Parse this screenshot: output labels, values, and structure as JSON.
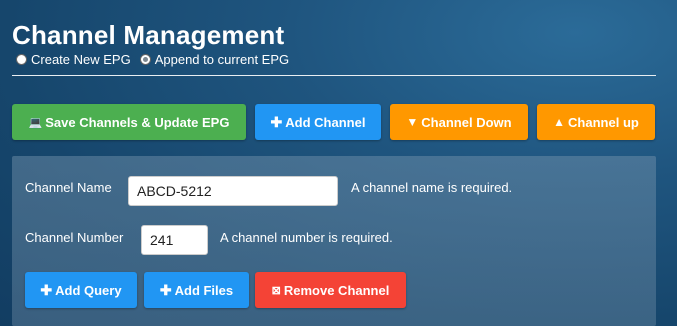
{
  "header": {
    "title": "Channel Management"
  },
  "epg_mode": {
    "options": [
      {
        "label": "Create New EPG",
        "checked": false
      },
      {
        "label": "Append to current EPG",
        "checked": true
      }
    ]
  },
  "toolbar": {
    "save_label": "Save Channels & Update EPG",
    "add_channel_label": "Add Channel",
    "channel_down_label": "Channel Down",
    "channel_up_label": "Channel up"
  },
  "channel_form": {
    "name_label": "Channel Name",
    "name_value": "ABCD-5212",
    "name_hint": "A channel name is required.",
    "number_label": "Channel Number",
    "number_value": "241",
    "number_hint": "A channel number is required.",
    "add_query_label": "Add Query",
    "add_files_label": "Add Files",
    "remove_label": "Remove Channel"
  },
  "colors": {
    "green": "#4caf50",
    "blue": "#2196f3",
    "orange": "#ff9800",
    "red": "#f44336"
  }
}
